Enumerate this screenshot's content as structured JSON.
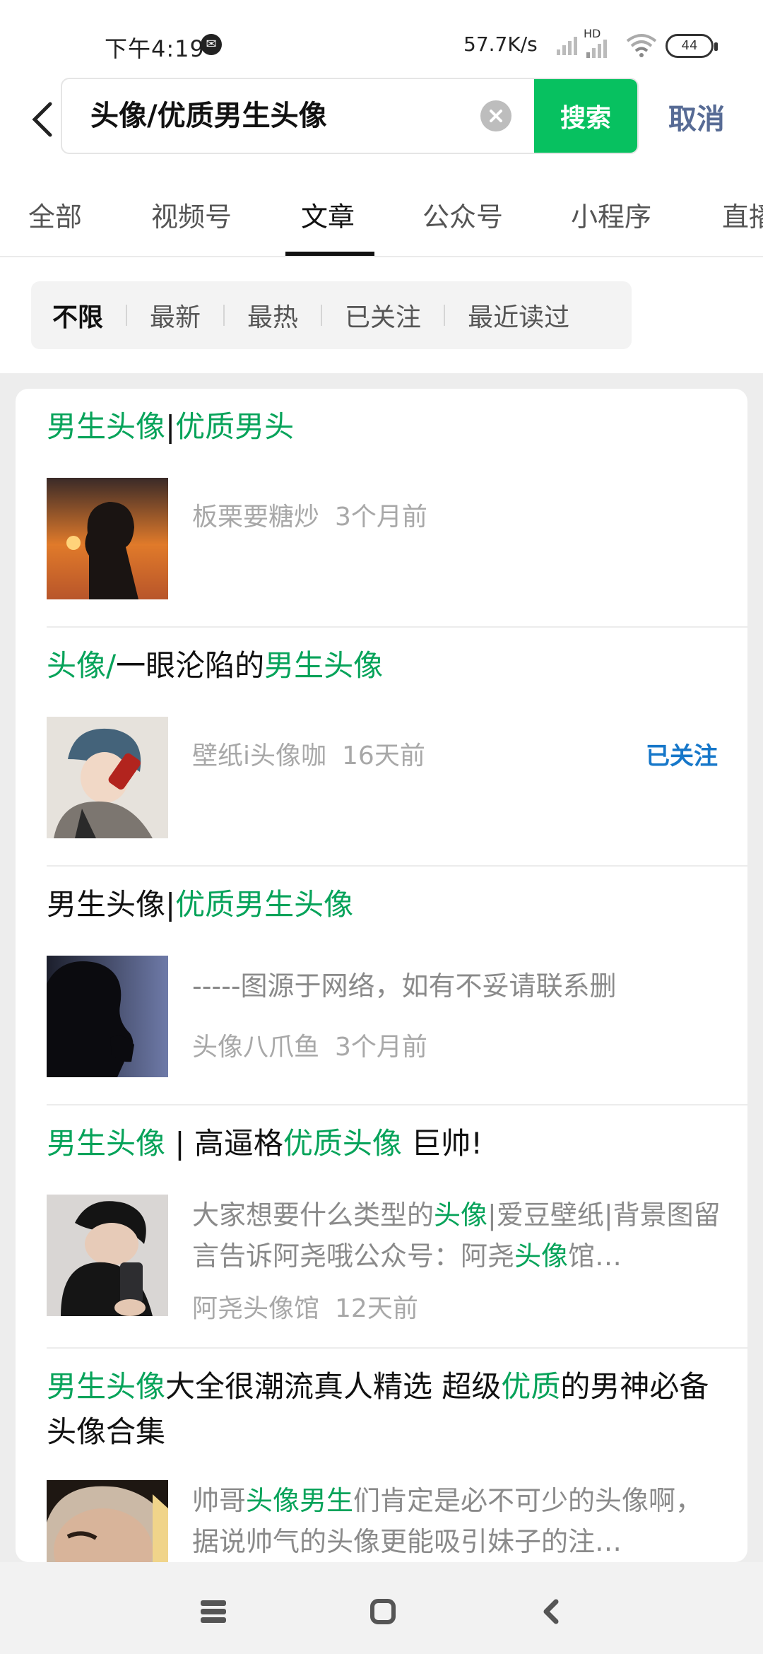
{
  "status_bar": {
    "time": "下午4:19",
    "net_speed": "57.7K/s",
    "hd_label": "HD",
    "battery": "44"
  },
  "search": {
    "query": "头像/优质男生头像",
    "search_label": "搜索",
    "cancel_label": "取消"
  },
  "tabs": [
    {
      "label": "全部"
    },
    {
      "label": "视频号"
    },
    {
      "label": "文章"
    },
    {
      "label": "公众号"
    },
    {
      "label": "小程序"
    },
    {
      "label": "直播"
    }
  ],
  "active_tab": "文章",
  "filters": [
    {
      "label": "不限"
    },
    {
      "label": "最新"
    },
    {
      "label": "最热"
    },
    {
      "label": "已关注"
    },
    {
      "label": "最近读过"
    }
  ],
  "active_filter": "不限",
  "results": [
    {
      "title_parts": [
        [
          "男生头像",
          true
        ],
        [
          "|",
          false
        ],
        [
          "优质男头",
          true
        ]
      ],
      "author": "板栗要糖炒",
      "time": "3个月前",
      "snippet": ""
    },
    {
      "title_parts": [
        [
          "头像/",
          true
        ],
        [
          "一眼沦陷的",
          false
        ],
        [
          "男生头像",
          true
        ]
      ],
      "author": "壁纸i头像咖",
      "time": "16天前",
      "badge": "已关注"
    },
    {
      "title_parts": [
        [
          "男生头像",
          false
        ],
        [
          "|",
          false
        ],
        [
          "优质男生头像",
          true
        ]
      ],
      "snippet": "-----图源于网络，如有不妥请联系删",
      "author": "头像八爪鱼",
      "time": "3个月前"
    },
    {
      "title_parts": [
        [
          "男生头像",
          true
        ],
        [
          " | 高逼格",
          false
        ],
        [
          "优质头像",
          true
        ],
        [
          " 巨帅!",
          false
        ]
      ],
      "snippet_parts": [
        [
          "大家想要什么类型的",
          false
        ],
        [
          "头像",
          true
        ],
        [
          "|爱豆壁纸|背景图留言告诉阿尧哦公众号：阿尧",
          false
        ],
        [
          "头像",
          true
        ],
        [
          "馆…",
          false
        ]
      ],
      "author": "阿尧头像馆",
      "time": "12天前"
    },
    {
      "title_parts": [
        [
          "男生头像",
          true
        ],
        [
          "大全很潮流真人精选 超级",
          false
        ],
        [
          "优质",
          true
        ],
        [
          "的男神必备头像合集",
          false
        ]
      ],
      "snippet_parts": [
        [
          "帅哥",
          false
        ],
        [
          "头像男生",
          true
        ],
        [
          "们肯定是必不可少的头像啊，据说帅气的头像更能吸引妹子的注…",
          false
        ]
      ]
    }
  ],
  "colors": {
    "accent_green": "#07c160",
    "highlight_green": "#07a35a",
    "link_blue": "#576b95",
    "badge_blue": "#1677c9"
  }
}
